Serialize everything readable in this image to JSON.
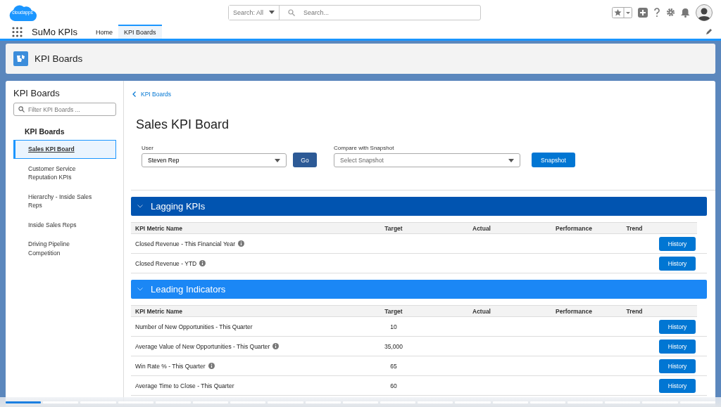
{
  "logo_text": "cloudapps",
  "search": {
    "scope": "Search: All",
    "placeholder": "Search..."
  },
  "app_name": "SuMo KPIs",
  "tabs": [
    {
      "label": "Home",
      "selected": false
    },
    {
      "label": "KPI Boards",
      "selected": true
    }
  ],
  "page_header": {
    "title": "KPI Boards"
  },
  "sidebar": {
    "title": "KPI Boards",
    "filter_placeholder": "Filter KPI Boards ...",
    "group": "KPI Boards",
    "items": [
      {
        "label": "Sales KPI Board",
        "selected": true
      },
      {
        "label": "Customer Service Reputation KPIs",
        "selected": false
      },
      {
        "label": "Hierarchy - Inside Sales Reps",
        "selected": false
      },
      {
        "label": "Inside Sales Reps",
        "selected": false
      },
      {
        "label": "Driving Pipeline Competition",
        "selected": false
      }
    ]
  },
  "breadcrumb": "KPI Boards",
  "board_title": "Sales KPI Board",
  "user_field": {
    "label": "User",
    "value": "Steven Rep"
  },
  "go_button": "Go",
  "snapshot_field": {
    "label": "Compare with Snapshot",
    "placeholder": "Select Snapshot"
  },
  "snapshot_button": "Snapshot",
  "sections": [
    {
      "title": "Lagging KPIs",
      "color": "#0154b0",
      "columns": [
        "KPI Metric Name",
        "Target",
        "Actual",
        "Performance",
        "Trend"
      ],
      "rows": [
        {
          "name": "Closed Revenue - This Financial Year",
          "info": true,
          "target": "",
          "button": "History"
        },
        {
          "name": "Closed Revenue - YTD",
          "info": true,
          "target": "",
          "button": "History"
        }
      ]
    },
    {
      "title": "Leading Indicators",
      "color": "#1b87f5",
      "columns": [
        "KPI Metric Name",
        "Target",
        "Actual",
        "Performance",
        "Trend"
      ],
      "rows": [
        {
          "name": "Number of New Opportunities - This Quarter",
          "info": false,
          "target": "10",
          "button": "History"
        },
        {
          "name": "Average Value of New Opportunities - This Quarter",
          "info": true,
          "target": "35,000",
          "button": "History"
        },
        {
          "name": "Win Rate % - This Quarter",
          "info": true,
          "target": "65",
          "button": "History"
        },
        {
          "name": "Average Time to Close - This Quarter",
          "info": false,
          "target": "60",
          "button": "History"
        }
      ]
    }
  ],
  "slide_indicator": [
    {
      "selected": true
    },
    {
      "selected": false
    },
    {
      "selected": false
    },
    {
      "selected": false
    },
    {
      "selected": false
    },
    {
      "selected": false
    },
    {
      "selected": false
    },
    {
      "selected": false
    },
    {
      "selected": false
    },
    {
      "selected": false
    },
    {
      "selected": false
    },
    {
      "selected": false
    },
    {
      "selected": false
    },
    {
      "selected": false
    },
    {
      "selected": false
    },
    {
      "selected": false
    },
    {
      "selected": false
    },
    {
      "selected": false
    },
    {
      "selected": false
    }
  ]
}
